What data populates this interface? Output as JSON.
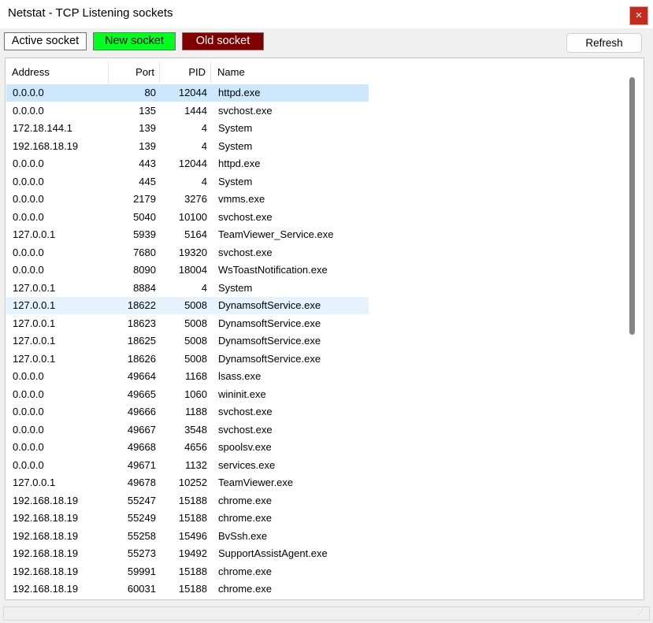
{
  "window": {
    "title": "Netstat - TCP Listening sockets",
    "close_glyph": "×"
  },
  "legend": {
    "active": "Active socket",
    "new": "New socket",
    "old": "Old socket"
  },
  "colors": {
    "new": "#00ff1e",
    "old": "#800000",
    "selected_row": "#cce8ff",
    "close": "#c42b1c"
  },
  "toolbar": {
    "refresh_label": "Refresh"
  },
  "table": {
    "columns": {
      "address": "Address",
      "port": "Port",
      "pid": "PID",
      "name": "Name"
    },
    "rows": [
      {
        "address": "0.0.0.0",
        "port": "80",
        "pid": "12044",
        "name": "httpd.exe"
      },
      {
        "address": "0.0.0.0",
        "port": "135",
        "pid": "1444",
        "name": "svchost.exe"
      },
      {
        "address": "172.18.144.1",
        "port": "139",
        "pid": "4",
        "name": "System"
      },
      {
        "address": "192.168.18.19",
        "port": "139",
        "pid": "4",
        "name": "System"
      },
      {
        "address": "0.0.0.0",
        "port": "443",
        "pid": "12044",
        "name": "httpd.exe"
      },
      {
        "address": "0.0.0.0",
        "port": "445",
        "pid": "4",
        "name": "System"
      },
      {
        "address": "0.0.0.0",
        "port": "2179",
        "pid": "3276",
        "name": "vmms.exe"
      },
      {
        "address": "0.0.0.0",
        "port": "5040",
        "pid": "10100",
        "name": "svchost.exe"
      },
      {
        "address": "127.0.0.1",
        "port": "5939",
        "pid": "5164",
        "name": "TeamViewer_Service.exe"
      },
      {
        "address": "0.0.0.0",
        "port": "7680",
        "pid": "19320",
        "name": "svchost.exe"
      },
      {
        "address": "0.0.0.0",
        "port": "8090",
        "pid": "18004",
        "name": "WsToastNotification.exe"
      },
      {
        "address": "127.0.0.1",
        "port": "8884",
        "pid": "4",
        "name": "System"
      },
      {
        "address": "127.0.0.1",
        "port": "18622",
        "pid": "5008",
        "name": "DynamsoftService.exe"
      },
      {
        "address": "127.0.0.1",
        "port": "18623",
        "pid": "5008",
        "name": "DynamsoftService.exe"
      },
      {
        "address": "127.0.0.1",
        "port": "18625",
        "pid": "5008",
        "name": "DynamsoftService.exe"
      },
      {
        "address": "127.0.0.1",
        "port": "18626",
        "pid": "5008",
        "name": "DynamsoftService.exe"
      },
      {
        "address": "0.0.0.0",
        "port": "49664",
        "pid": "1168",
        "name": "lsass.exe"
      },
      {
        "address": "0.0.0.0",
        "port": "49665",
        "pid": "1060",
        "name": "wininit.exe"
      },
      {
        "address": "0.0.0.0",
        "port": "49666",
        "pid": "1188",
        "name": "svchost.exe"
      },
      {
        "address": "0.0.0.0",
        "port": "49667",
        "pid": "3548",
        "name": "svchost.exe"
      },
      {
        "address": "0.0.0.0",
        "port": "49668",
        "pid": "4656",
        "name": "spoolsv.exe"
      },
      {
        "address": "0.0.0.0",
        "port": "49671",
        "pid": "1132",
        "name": "services.exe"
      },
      {
        "address": "127.0.0.1",
        "port": "49678",
        "pid": "10252",
        "name": "TeamViewer.exe"
      },
      {
        "address": "192.168.18.19",
        "port": "55247",
        "pid": "15188",
        "name": "chrome.exe"
      },
      {
        "address": "192.168.18.19",
        "port": "55249",
        "pid": "15188",
        "name": "chrome.exe"
      },
      {
        "address": "192.168.18.19",
        "port": "55258",
        "pid": "15496",
        "name": "BvSsh.exe"
      },
      {
        "address": "192.168.18.19",
        "port": "55273",
        "pid": "19492",
        "name": "SupportAssistAgent.exe"
      },
      {
        "address": "192.168.18.19",
        "port": "59991",
        "pid": "15188",
        "name": "chrome.exe"
      },
      {
        "address": "192.168.18.19",
        "port": "60031",
        "pid": "15188",
        "name": "chrome.exe"
      }
    ],
    "selected_row_index": 0,
    "hover_row_index": 12
  }
}
